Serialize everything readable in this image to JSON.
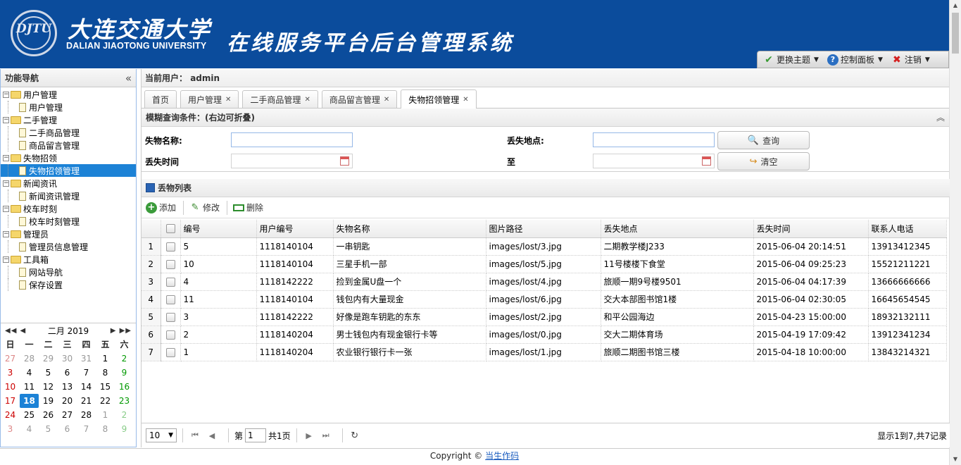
{
  "header": {
    "univ_cn": "大连交通大学",
    "univ_en": "DALIAN JIAOTONG UNIVERSITY",
    "system_title": "在线服务平台后台管理系统",
    "logo_mark": "DJTU",
    "toolbar": {
      "theme_label": "更换主题",
      "control_label": "控制面板",
      "logout_label": "注销"
    }
  },
  "west": {
    "title": "功能导航",
    "tree": [
      {
        "label": "用户管理",
        "children": [
          "用户管理"
        ]
      },
      {
        "label": "二手管理",
        "children": [
          "二手商品管理",
          "商品留言管理"
        ]
      },
      {
        "label": "失物招领",
        "children": [
          "失物招领管理"
        ]
      },
      {
        "label": "新闻资讯",
        "children": [
          "新闻资讯管理"
        ]
      },
      {
        "label": "校车时刻",
        "children": [
          "校车时刻管理"
        ]
      },
      {
        "label": "管理员",
        "children": [
          "管理员信息管理"
        ]
      },
      {
        "label": "工具箱",
        "children": [
          "网站导航",
          "保存设置"
        ]
      }
    ],
    "selected": "失物招领管理"
  },
  "calendar": {
    "title": "二月 2019",
    "weekdays": [
      "日",
      "一",
      "二",
      "三",
      "四",
      "五",
      "六"
    ],
    "weeks": [
      [
        "27",
        "28",
        "29",
        "30",
        "31",
        "1",
        "2"
      ],
      [
        "3",
        "4",
        "5",
        "6",
        "7",
        "8",
        "9"
      ],
      [
        "10",
        "11",
        "12",
        "13",
        "14",
        "15",
        "16"
      ],
      [
        "17",
        "18",
        "19",
        "20",
        "21",
        "22",
        "23"
      ],
      [
        "24",
        "25",
        "26",
        "27",
        "28",
        "1",
        "2"
      ],
      [
        "3",
        "4",
        "5",
        "6",
        "7",
        "8",
        "9"
      ]
    ],
    "today": "18"
  },
  "center": {
    "current_user_label": "当前用户：",
    "current_user": "admin",
    "tabs": [
      {
        "label": "首页",
        "closable": false
      },
      {
        "label": "用户管理",
        "closable": true
      },
      {
        "label": "二手商品管理",
        "closable": true
      },
      {
        "label": "商品留言管理",
        "closable": true
      },
      {
        "label": "失物招领管理",
        "closable": true,
        "active": true
      }
    ],
    "query": {
      "title": "模糊查询条件：(右边可折叠)",
      "name_label": "失物名称:",
      "place_label": "丢失地点:",
      "time_label": "丢失时间",
      "to_label": "至",
      "search_label": "查询",
      "clear_label": "清空"
    },
    "grid": {
      "title": "丢物列表",
      "add_label": "添加",
      "edit_label": "修改",
      "delete_label": "删除",
      "columns": [
        "编号",
        "用户编号",
        "失物名称",
        "图片路径",
        "丢失地点",
        "丢失时间",
        "联系人电话"
      ],
      "rows": [
        [
          "5",
          "1118140104",
          "一串钥匙",
          "images/lost/3.jpg",
          "二期教学楼J233",
          "2015-06-04 20:14:51",
          "13913412345"
        ],
        [
          "10",
          "1118140104",
          "三星手机一部",
          "images/lost/5.jpg",
          "11号楼楼下食堂",
          "2015-06-04 09:25:23",
          "15521211221"
        ],
        [
          "4",
          "1118142222",
          "捡到金属U盘一个",
          "images/lost/4.jpg",
          "旅顺一期9号楼9501",
          "2015-06-04 04:17:39",
          "13666666666"
        ],
        [
          "11",
          "1118140104",
          "钱包内有大量现金",
          "images/lost/6.jpg",
          "交大本部图书馆1楼",
          "2015-06-04 02:30:05",
          "16645654545"
        ],
        [
          "3",
          "1118142222",
          "好像是跑车钥匙的东东",
          "images/lost/2.jpg",
          "和平公园海边",
          "2015-04-23 15:00:00",
          "18932132111"
        ],
        [
          "2",
          "1118140204",
          "男士钱包内有现金银行卡等",
          "images/lost/0.jpg",
          "交大二期体育场",
          "2015-04-19 17:09:42",
          "13912341234"
        ],
        [
          "1",
          "1118140204",
          "农业银行银行卡一张",
          "images/lost/1.jpg",
          "旅顺二期图书馆三楼",
          "2015-04-18 10:00:00",
          "13843214321"
        ]
      ]
    },
    "pager": {
      "page_size": "10",
      "page_prefix": "第",
      "page_number": "1",
      "page_total": "共1页",
      "info": "显示1到7,共7记录"
    }
  },
  "footer": {
    "copyright": "Copyright ©",
    "author": "当生作码"
  }
}
